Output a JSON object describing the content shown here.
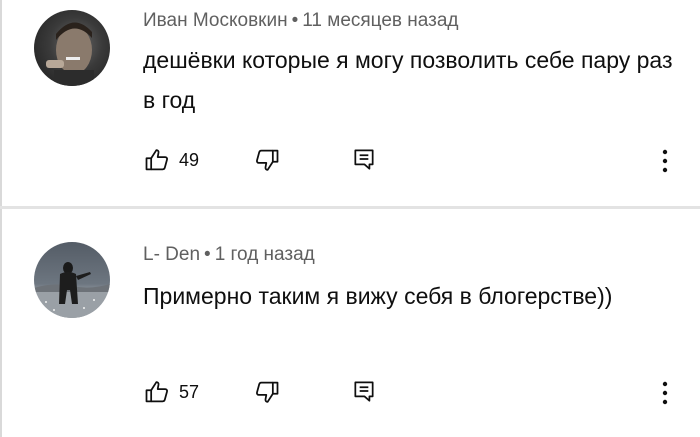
{
  "comments": [
    {
      "author": "Иван Московкин",
      "separator": "•",
      "time": "11 месяцев назад",
      "text": "дешёвки которые я могу позволить себе пару раз в год",
      "likes": "49"
    },
    {
      "author": "L- Den",
      "separator": "•",
      "time": "1 год назад",
      "text": "Примерно таким я вижу себя в блогерстве))",
      "likes": "57"
    }
  ],
  "icons": {
    "like": "thumb-up-icon",
    "dislike": "thumb-down-icon",
    "reply": "reply-icon",
    "more": "more-vertical-icon"
  }
}
